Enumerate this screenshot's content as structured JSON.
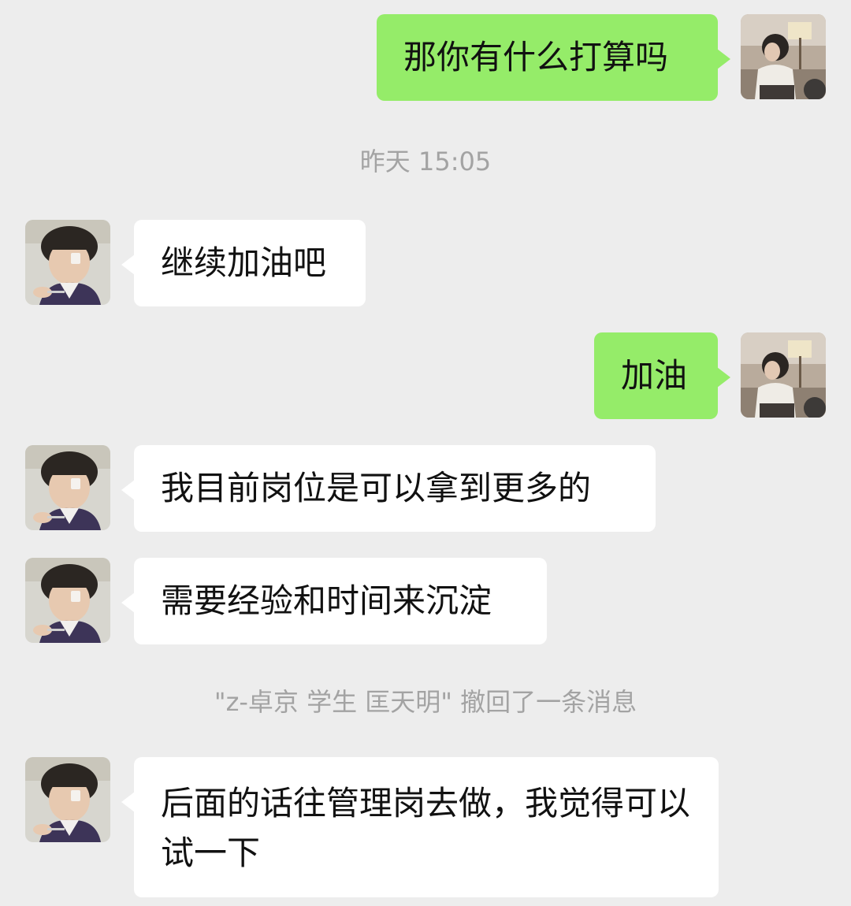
{
  "chat": {
    "timestamp": "昨天 15:05",
    "recall_notice": "\"z-卓京 学生 匡天明\" 撤回了一条消息",
    "messages": [
      {
        "sender": "self",
        "text": "那你有什么打算吗"
      },
      {
        "sender": "other",
        "text": "继续加油吧"
      },
      {
        "sender": "self",
        "text": "加油"
      },
      {
        "sender": "other",
        "text": "我目前岗位是可以拿到更多的"
      },
      {
        "sender": "other",
        "text": "需要经验和时间来沉淀"
      },
      {
        "sender": "other",
        "text": "后面的话往管理岗去做，我觉得可以试一下"
      }
    ]
  },
  "colors": {
    "background": "#ededed",
    "self_bubble": "#95ec69",
    "other_bubble": "#ffffff",
    "system_text": "#a3a3a3"
  },
  "icons": {
    "self_avatar": "avatar-photo-girl",
    "other_avatar": "avatar-photo-boy"
  }
}
